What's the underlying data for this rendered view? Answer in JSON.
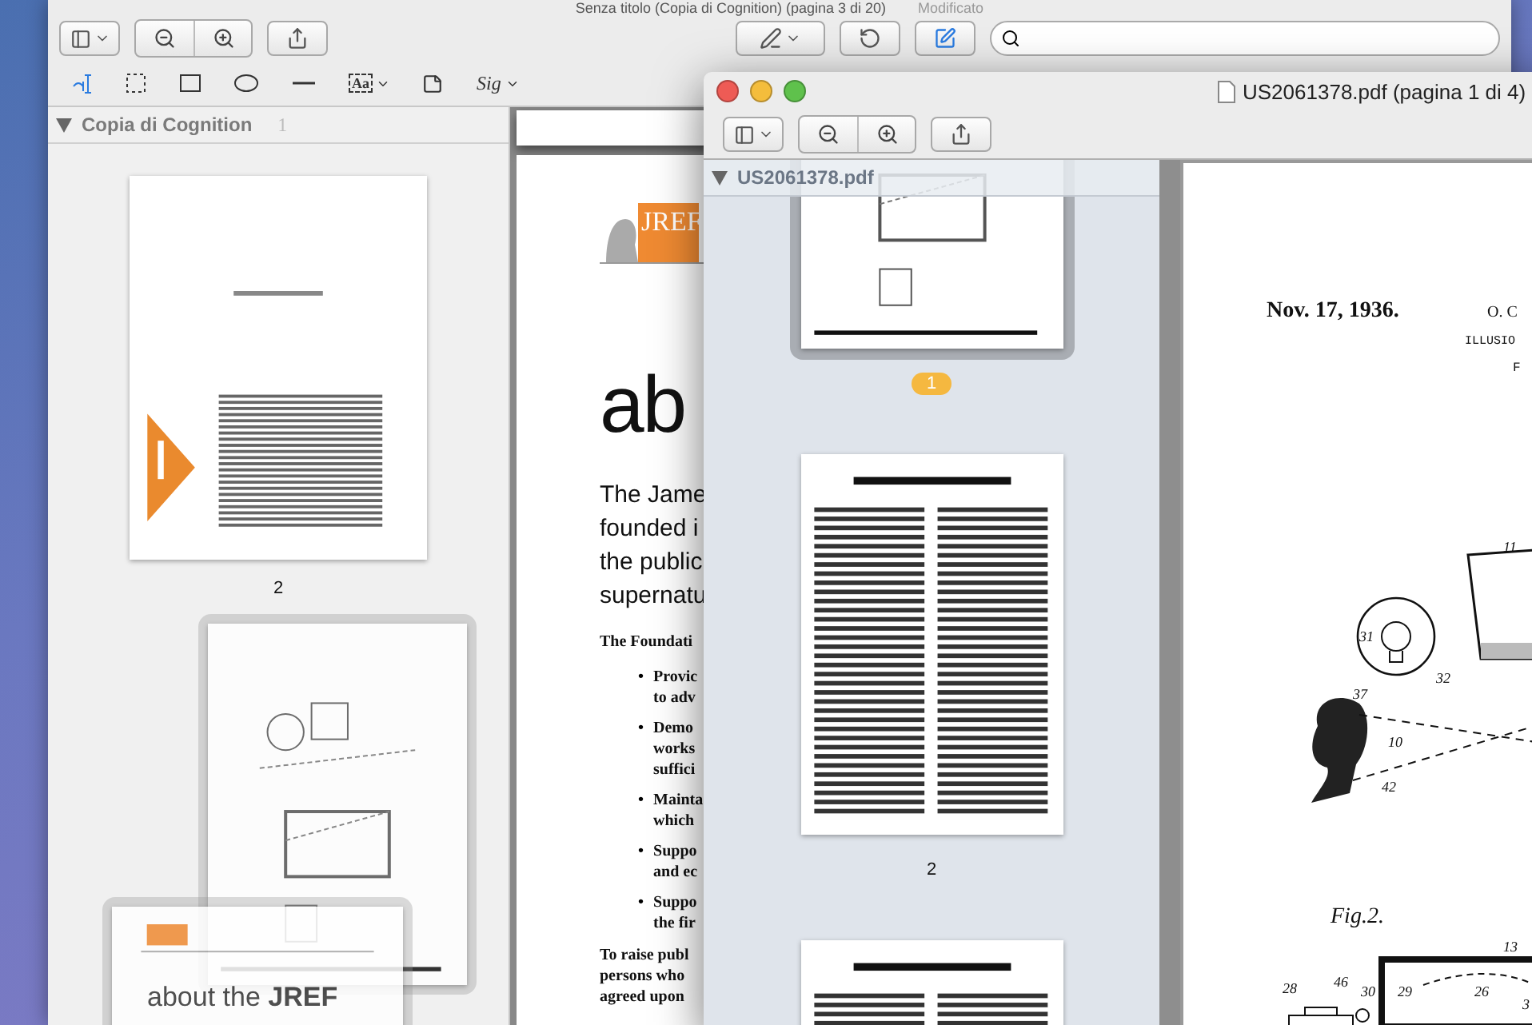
{
  "back_window": {
    "title": "Senza titolo (Copia di Cognition) (pagina 3 di 20)",
    "status": "Modificato",
    "tools": [
      {
        "kind": "text",
        "selected": true
      },
      {
        "kind": "rect_select",
        "selected": false
      },
      {
        "kind": "rectangle",
        "selected": false
      },
      {
        "kind": "oval",
        "selected": false
      },
      {
        "kind": "line",
        "selected": false
      },
      {
        "kind": "textbox",
        "label": "Aa",
        "selected": false
      },
      {
        "kind": "note",
        "selected": false
      },
      {
        "kind": "signature",
        "label": "Sig",
        "selected": false
      }
    ],
    "sidebar": {
      "title": "Copia di Cognition",
      "marker": "1",
      "pages": [
        {
          "kind": "notice",
          "label": "2",
          "selected": false
        },
        {
          "kind": "patent",
          "selected": true
        },
        {
          "kind": "jref",
          "selected": true,
          "heading": "about the ",
          "heading_bold": "JREF"
        }
      ]
    },
    "document": {
      "logo": "JREF",
      "heading": "ab",
      "intro": [
        "The Jame",
        "founded i",
        "the public",
        "supernatu"
      ],
      "lead": "The Foundati",
      "bullets": [
        {
          "mark": "•",
          "lines": [
            "Provic",
            "to adv"
          ]
        },
        {
          "mark": "•",
          "lines": [
            "Demo",
            "works",
            "suffici"
          ]
        },
        {
          "mark": "•",
          "lines": [
            "Mainta",
            "which"
          ]
        },
        {
          "mark": "•",
          "lines": [
            "Suppo",
            "and ec"
          ]
        },
        {
          "mark": "•",
          "lines": [
            "Suppo",
            "the fir"
          ]
        }
      ],
      "closing": [
        "To raise publ",
        "persons who",
        "agreed upon"
      ]
    }
  },
  "front_window": {
    "title": "US2061378.pdf (pagina 1 di 4)",
    "sidebar": {
      "title": "US2061378.pdf",
      "pages": [
        {
          "kind": "drawing",
          "label": "1",
          "selected": true
        },
        {
          "kind": "text",
          "label": "2",
          "selected": false
        },
        {
          "kind": "text",
          "selected": false
        }
      ]
    },
    "page": {
      "date": "Nov. 17, 1936.",
      "inventor": "O. C",
      "title": "ILLUSIO",
      "subtitle": "F",
      "figure": "Fig.2.",
      "callouts": [
        "11",
        "31",
        "32",
        "37",
        "10",
        "42",
        "13",
        "28",
        "46",
        "30",
        "29",
        "26",
        "3"
      ]
    }
  }
}
